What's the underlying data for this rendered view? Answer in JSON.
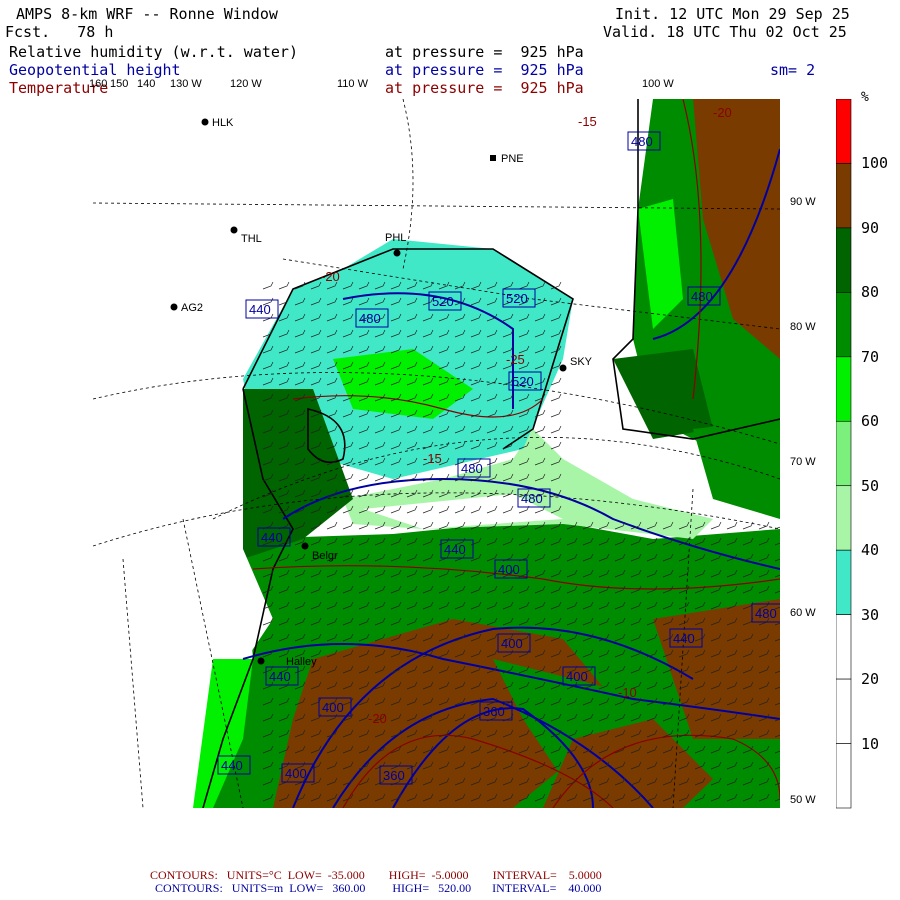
{
  "header": {
    "title": "AMPS 8-km WRF -- Ronne Window",
    "forecast": "Fcst.   78 h",
    "init": "Init. 12 UTC Mon 29 Sep 25",
    "valid": "Valid. 18 UTC Thu 02 Oct 25"
  },
  "fields": [
    {
      "name": "Relative humidity (w.r.t. water)",
      "level": "at pressure =  925 hPa"
    },
    {
      "name": "Geopotential height",
      "level": "at pressure =  925 hPa",
      "extra": "sm= 2"
    },
    {
      "name": "Temperature",
      "level": "at pressure =  925 hPa"
    }
  ],
  "lon_labels": [
    "160",
    "150",
    "140",
    "130 W",
    "120 W",
    "110 W",
    "100 W"
  ],
  "lat_labels": [
    "90 W",
    "80 W",
    "70 W",
    "60 W",
    "50 W"
  ],
  "stations": [
    "HLK",
    "PNE",
    "THL",
    "PHL",
    "AG2",
    "SKY",
    "Belgr",
    "Halley"
  ],
  "height_labels": [
    "480",
    "480",
    "440",
    "480",
    "520",
    "520",
    "520",
    "480",
    "480",
    "440",
    "400",
    "480",
    "440",
    "400",
    "400",
    "360",
    "400",
    "400",
    "360",
    "440",
    "440",
    "440"
  ],
  "temp_labels": [
    "-15",
    "-20",
    "-20",
    "-25",
    "-15",
    "-10",
    "-20"
  ],
  "colorbar": {
    "unit": "%",
    "labels": [
      "100",
      "90",
      "80",
      "70",
      "60",
      "50",
      "40",
      "30",
      "20",
      "10"
    ],
    "colors": [
      "#ff0000",
      "#7a3b00",
      "#006400",
      "#008c00",
      "#00f000",
      "#7cf07c",
      "#a8f5a8",
      "#40e8c8",
      "#ffffff",
      "#ffffff",
      "#ffffff"
    ]
  },
  "footer": {
    "temp": {
      "label": "CONTOURS:",
      "units": "UNITS=°C",
      "low": "LOW=  -35.000",
      "high": "HIGH=  -5.0000",
      "interval": "INTERVAL=    5.0000"
    },
    "height": {
      "label": "CONTOURS:",
      "units": "UNITS=m",
      "low": "LOW=   360.00",
      "high": "HIGH=   520.00",
      "interval": "INTERVAL=    40.000"
    }
  }
}
